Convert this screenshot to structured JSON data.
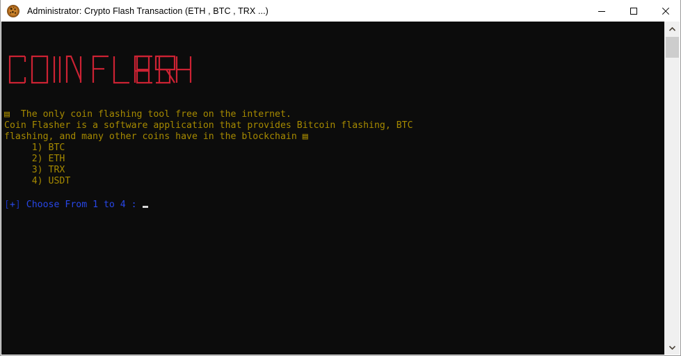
{
  "window": {
    "title": "Administrator:  Crypto Flash Transaction (ETH , BTC , TRX ...)",
    "icon": "coin-icon",
    "controls": {
      "minimize_label": "Minimize",
      "maximize_label": "Maximize",
      "close_label": "Close"
    }
  },
  "console": {
    "background_color": "#0c0c0c",
    "banner": {
      "text": "COIN FLASHER",
      "color": "#cc2233",
      "ascii": "█▀▀▀▄ █▀▀▀█ ▀█▀ █▄  █   █▀▀▀ █    █▀▀▄ █▀▀▀▄ █  █ █▀▀▀ █▀▀▄\n█     █   █  █  █ █ █   █▀▀  █    █▀▀█ ▀▀▀▀█ █▀▀█ █▀▀  █▀▀▄\n█▄▄▄▀ █▄▄▄█ ▄█▄ █  ▀█   █    █▄▄▄ █  █ █▄▄▄▀ █  █ █▄▄▄ █  █"
    },
    "lines": [
      {
        "id": "tagline",
        "text": "▤  The only coin flashing tool free on the internet.",
        "color": "#a68a00"
      },
      {
        "id": "description-1",
        "text": "Coin Flasher is a software application that provides Bitcoin flashing, BTC",
        "color": "#a68a00"
      },
      {
        "id": "description-2",
        "text": "flashing, and many other coins have in the blockchain ▤",
        "color": "#a68a00"
      }
    ],
    "menu": {
      "color": "#a68a00",
      "options": [
        {
          "number": "1)",
          "label": "BTC"
        },
        {
          "number": "2)",
          "label": "ETH"
        },
        {
          "number": "3)",
          "label": "TRX"
        },
        {
          "number": "4)",
          "label": "USDT"
        }
      ]
    },
    "prompt": {
      "bracket_open": "[",
      "marker": "+",
      "bracket_close": "]",
      "text": " Choose From 1 to 4 :",
      "color": "#2847e8",
      "cursor": "_"
    }
  },
  "scrollbar": {
    "up_arrow": "▲",
    "down_arrow": "▼",
    "thumb_label": "scroll-thumb"
  }
}
